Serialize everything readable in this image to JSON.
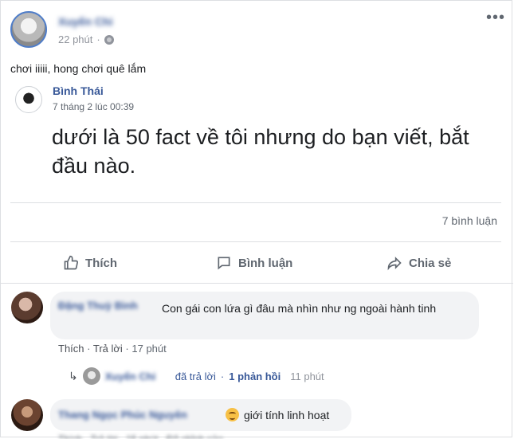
{
  "post": {
    "poster_name": "Xuyến Chi",
    "time": "22 phút",
    "text": "chơi iiiii, hong chơi quê lắm",
    "more_icon": "more-icon"
  },
  "shared": {
    "name": "Bình Thái",
    "time": "7 tháng 2 lúc 00:39",
    "body": "dưới là 50 fact về tôi nhưng do bạn viết, bắt đầu nào."
  },
  "stats": {
    "comment_count": "7 bình luận"
  },
  "actions": {
    "like": "Thích",
    "comment": "Bình luận",
    "share": "Chia sẻ"
  },
  "comments": [
    {
      "author": "Đặng Thuỳ Bình",
      "text": "Con gái con lứa gì đâu mà nhìn như ng ngoài hành tinh",
      "like": "Thích",
      "reply": "Trả lời",
      "time": "17 phút",
      "replies": {
        "author": "Xuyến Chi",
        "replied": "đã trả lời",
        "count": "1 phản hồi",
        "time": "11 phút"
      }
    },
    {
      "author": "Thang Ngọc Phúc Nguyên",
      "text": "giới tính linh hoạt",
      "actions_blurred": "Thích · Trả lời · 15 phút · Đã chỉnh sửa"
    }
  ],
  "colors": {
    "link": "#385898",
    "meta": "#90949c",
    "bubble": "#f2f3f5",
    "border": "#dddfe2"
  }
}
